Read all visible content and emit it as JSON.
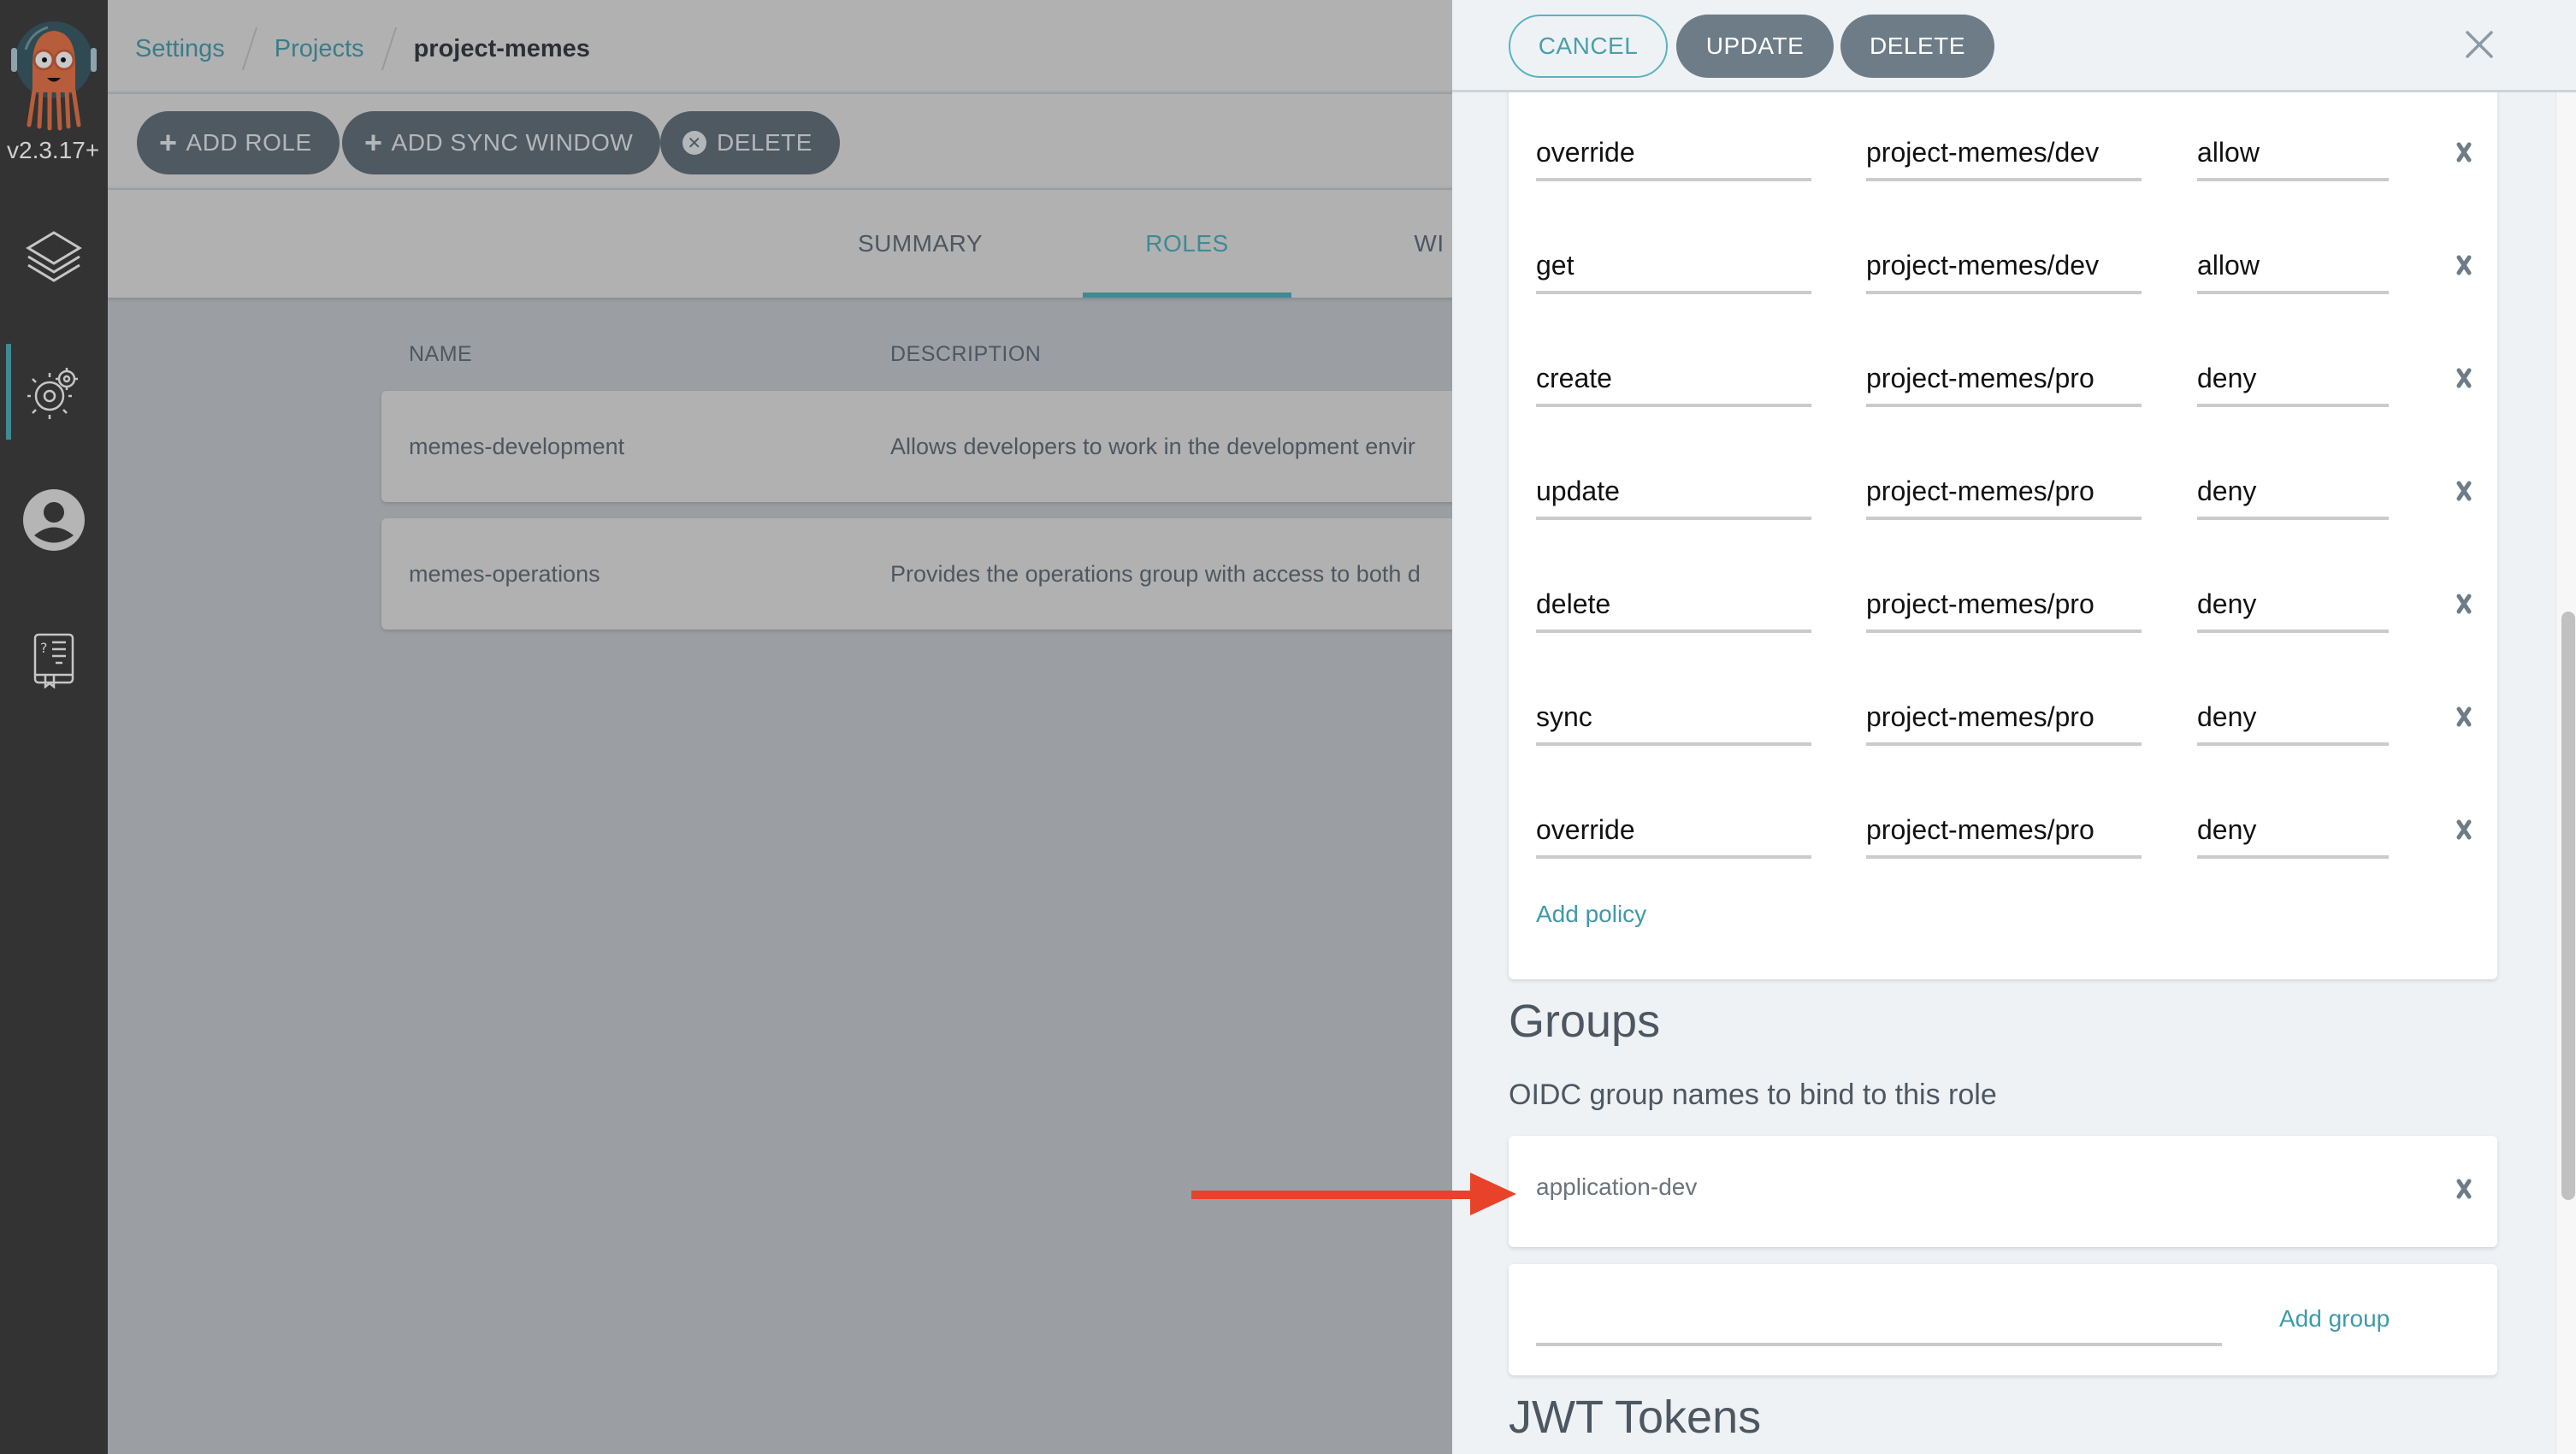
{
  "app": {
    "version": "v2.3.17+"
  },
  "sidebar": {
    "items": [
      {
        "name": "applications",
        "icon": "layers-icon",
        "active": false
      },
      {
        "name": "settings",
        "icon": "gear-icon",
        "active": true
      },
      {
        "name": "user-info",
        "icon": "user-icon",
        "active": false
      },
      {
        "name": "documentation",
        "icon": "help-book-icon",
        "active": false
      }
    ]
  },
  "breadcrumb": {
    "items": [
      "Settings",
      "Projects"
    ],
    "current": "project-memes"
  },
  "toolbar": {
    "add_role": "ADD ROLE",
    "add_sync_window": "ADD SYNC WINDOW",
    "delete": "DELETE"
  },
  "tabs": [
    {
      "label": "SUMMARY",
      "active": false
    },
    {
      "label": "ROLES",
      "active": true
    },
    {
      "label": "WI",
      "active": false
    }
  ],
  "roles_table": {
    "columns": [
      "NAME",
      "DESCRIPTION"
    ],
    "rows": [
      {
        "name": "memes-development",
        "description": "Allows developers to work in the development envir"
      },
      {
        "name": "memes-operations",
        "description": "Provides the operations group with access to both d"
      }
    ]
  },
  "panel": {
    "cancel": "CANCEL",
    "update": "UPDATE",
    "delete": "DELETE",
    "policies": [
      {
        "action": "override",
        "object": "project-memes/dev",
        "permission": "allow"
      },
      {
        "action": "get",
        "object": "project-memes/dev",
        "permission": "allow"
      },
      {
        "action": "create",
        "object": "project-memes/pro",
        "permission": "deny"
      },
      {
        "action": "update",
        "object": "project-memes/pro",
        "permission": "deny"
      },
      {
        "action": "delete",
        "object": "project-memes/pro",
        "permission": "deny"
      },
      {
        "action": "sync",
        "object": "project-memes/pro",
        "permission": "deny"
      },
      {
        "action": "override",
        "object": "project-memes/pro",
        "permission": "deny"
      }
    ],
    "add_policy": "Add policy",
    "groups_heading": "Groups",
    "groups_subtitle": "OIDC group names to bind to this role",
    "groups": [
      "application-dev"
    ],
    "new_group_value": "",
    "add_group": "Add group",
    "jwt_heading": "JWT Tokens"
  },
  "annotation": {
    "arrow_color": "#e8422a",
    "points_to": "application-dev"
  },
  "scroll": {
    "panel_scroll_position": 0.55
  },
  "colors": {
    "accent": "#3f8a95",
    "link": "#3f9aa8",
    "button": "#6e7c87"
  }
}
